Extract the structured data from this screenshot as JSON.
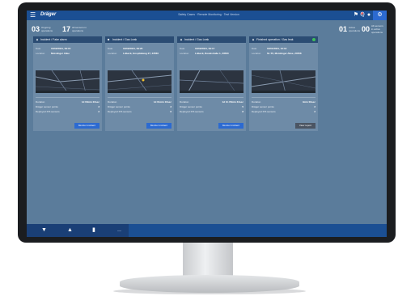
{
  "app": {
    "brand": "Dräger",
    "title": "Safety Cases · Remote Monitoring · Test Version"
  },
  "summary": {
    "left": [
      {
        "num": "03",
        "label": "Ongoing operations"
      },
      {
        "num": "17",
        "label": "All sensors in operations"
      }
    ],
    "right": [
      {
        "num": "01",
        "label": "Active operations"
      },
      {
        "num": "00",
        "label": "All sensors in active operations"
      }
    ]
  },
  "cards": [
    {
      "title": "Incident / Fake alarm",
      "date_label": "Date",
      "date": "10/02/2021, 09:15",
      "location_label": "Location",
      "location": "Moislinger Allee",
      "duration_label": "Duration",
      "duration": "1d 00min 23sec",
      "points_label": "Dräger sensor points",
      "points": "3",
      "sensors_label": "Deployed X/S sensors",
      "sensors": "2",
      "button": "Monitor incident",
      "status_ok": false
    },
    {
      "title": "Incident / Gas Leak",
      "date_label": "Date",
      "date": "10/02/2021, 09:25",
      "location_label": "Location",
      "location": "Lübeck, Hospitalweg 27, 23560",
      "duration_label": "Duration",
      "duration": "1d 01min 16sec",
      "points_label": "Dräger sensor points",
      "points": "3",
      "sensors_label": "Deployed X/S sensors",
      "sensors": "6",
      "button": "Monitor incident",
      "status_ok": false
    },
    {
      "title": "Incident / Gas Leak",
      "date_label": "Date",
      "date": "10/02/2021, 09:17",
      "location_label": "Location",
      "location": "Lübeck, Revalstraße 1, 23560",
      "duration_label": "Duration",
      "duration": "1d 1h 05min 34sec",
      "points_label": "Dräger sensor points",
      "points": "5",
      "sensors_label": "Deployed X/S sensors",
      "sensors": "8",
      "button": "Monitor incident",
      "status_ok": false
    },
    {
      "title": "Finished operation / Gas leak",
      "date_label": "Date",
      "date": "10/01/2021, 10:12",
      "location_label": "Location",
      "location": "St. 55, Moislinger Allee, 23558",
      "duration_label": "Duration",
      "duration": "4min 09sec",
      "points_label": "Dräger sensor points",
      "points": "2",
      "sensors_label": "Deployed X/S sensors",
      "sensors": "2",
      "button": "View report",
      "status_ok": true
    }
  ],
  "icons": {
    "menu": "menu-icon",
    "alert": "alert-icon",
    "bluetooth": "bluetooth-icon",
    "user": "user-icon",
    "settings": "gear-icon",
    "filter": "filter-icon",
    "map": "map-icon",
    "device": "device-icon"
  },
  "colors": {
    "app_bar": "#1b4f93",
    "background": "#5b7c9b",
    "card": "#6e8ba7",
    "card_header": "#2b4c73",
    "primary_button": "#2c6ad1",
    "secondary_button": "#4b5563",
    "status_ok": "#3fbf5a"
  }
}
